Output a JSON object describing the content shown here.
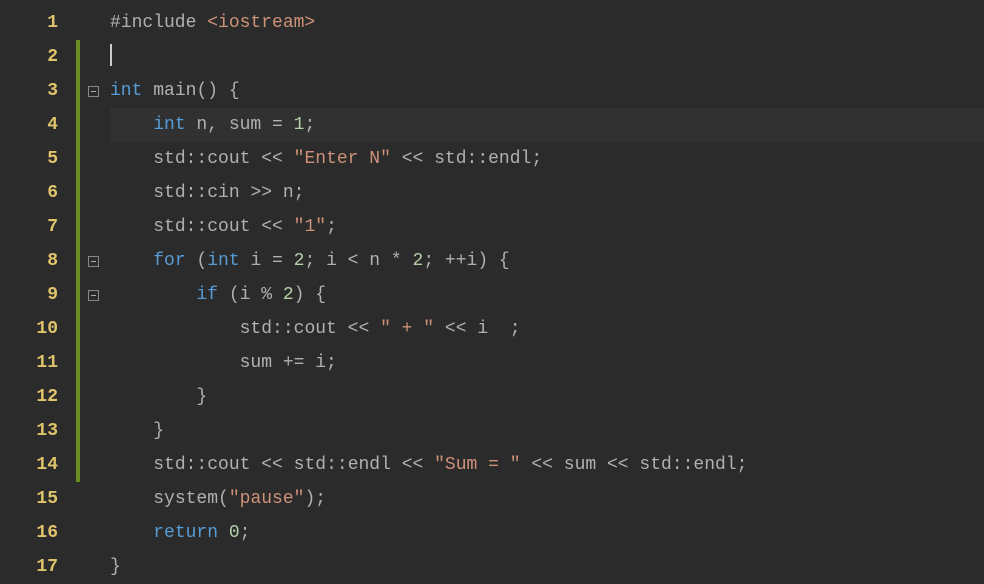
{
  "gutter": {
    "lines": [
      "1",
      "2",
      "3",
      "4",
      "5",
      "6",
      "7",
      "8",
      "9",
      "10",
      "11",
      "12",
      "13",
      "14",
      "15",
      "16",
      "17"
    ]
  },
  "folds": {
    "positions": [
      3,
      8,
      9
    ]
  },
  "changeBars": {
    "from": 2,
    "to": 14
  },
  "code": {
    "l1": {
      "preproc": "#include ",
      "inc": "<iostream>"
    },
    "l3": {
      "kw1": "int",
      "sp1": " ",
      "fn": "main",
      "rest": "() {"
    },
    "l4": {
      "indent": "    ",
      "kw": "int",
      "rest": " n, sum = ",
      "num": "1",
      "semi": ";"
    },
    "l5": {
      "indent": "    ",
      "ns1": "std",
      "op1": "::",
      "id1": "cout",
      "op2": " << ",
      "str": "\"Enter N\"",
      "op3": " << ",
      "ns2": "std",
      "op4": "::",
      "id2": "endl",
      "semi": ";"
    },
    "l6": {
      "indent": "    ",
      "ns": "std",
      "op1": "::",
      "id": "cin",
      "op2": " >> ",
      "var": "n",
      "semi": ";"
    },
    "l7": {
      "indent": "    ",
      "ns": "std",
      "op1": "::",
      "id": "cout",
      "op2": " << ",
      "str": "\"1\"",
      "semi": ";"
    },
    "l8": {
      "indent": "    ",
      "kw": "for",
      "sp": " (",
      "kw2": "int",
      "rest1": " i = ",
      "num1": "2",
      "rest2": "; i < n * ",
      "num2": "2",
      "rest3": "; ++i) {"
    },
    "l9": {
      "indent": "        ",
      "kw": "if",
      "rest": " (i % ",
      "num": "2",
      "rest2": ") {"
    },
    "l10": {
      "indent": "            ",
      "ns": "std",
      "op1": "::",
      "id": "cout",
      "op2": " << ",
      "str": "\" + \"",
      "op3": " << ",
      "var": "i",
      "sp": "  ",
      "semi": ";"
    },
    "l11": {
      "indent": "            ",
      "rest": "sum += i;"
    },
    "l12": {
      "indent": "        ",
      "brace": "}"
    },
    "l13": {
      "indent": "    ",
      "brace": "}"
    },
    "l14": {
      "indent": "    ",
      "ns1": "std",
      "op1": "::",
      "id1": "cout",
      "op2": " << ",
      "ns2": "std",
      "op3": "::",
      "id2": "endl",
      "op4": " << ",
      "str": "\"Sum = \"",
      "op5": " << ",
      "var": "sum",
      "op6": " << ",
      "ns3": "std",
      "op7": "::",
      "id3": "endl",
      "semi": ";"
    },
    "l15": {
      "indent": "    ",
      "fn": "system",
      "rest1": "(",
      "str": "\"pause\"",
      "rest2": ");"
    },
    "l16": {
      "indent": "    ",
      "kw": "return",
      "sp": " ",
      "num": "0",
      "semi": ";"
    },
    "l17": {
      "brace": "}"
    }
  }
}
